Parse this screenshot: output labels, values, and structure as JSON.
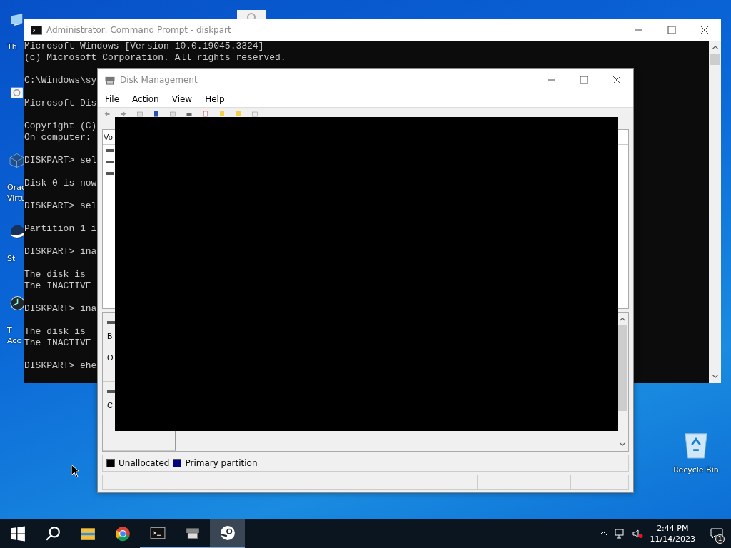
{
  "desktop_icons": [
    {
      "kind": "monitor",
      "labels": [
        "Th"
      ]
    },
    {
      "kind": "settings"
    },
    {
      "kind": "virtualbox",
      "labels": [
        "Orac",
        "Virtu"
      ]
    },
    {
      "kind": "steam",
      "labels": [
        "St"
      ]
    },
    {
      "kind": "clock",
      "labels": [
        "T",
        "Acc"
      ]
    }
  ],
  "recycle_bin": {
    "label": "Recycle Bin"
  },
  "command_prompt": {
    "title": "Administrator: Command Prompt - diskpart",
    "blocks": [
      [
        "Microsoft Windows [Version 10.0.19045.3324]",
        "(c) Microsoft Corporation. All rights reserved."
      ],
      [
        "C:\\Windows\\sy"
      ],
      [
        "Microsoft Dis"
      ],
      [
        "Copyright (C)",
        "On computer:"
      ],
      [
        "DISKPART> sel"
      ],
      [
        "Disk 0 is now"
      ],
      [
        "DISKPART> sel"
      ],
      [
        "Partition 1 i"
      ],
      [
        "DISKPART> ina"
      ],
      [
        "The disk is",
        "The INACTIVE"
      ],
      [
        "DISKPART> ina"
      ],
      [
        "The disk is",
        "The INACTIVE"
      ],
      [
        "DISKPART> ehe"
      ]
    ]
  },
  "disk_management": {
    "title": "Disk Management",
    "menu": [
      "File",
      "Action",
      "View",
      "Help"
    ],
    "volume_column": "Vo",
    "disk_labels": [
      [
        "B",
        "O"
      ],
      [
        "C"
      ]
    ],
    "legend": [
      {
        "label": "Unallocated",
        "color": "#000000"
      },
      {
        "label": "Primary partition",
        "color": "#000080"
      }
    ]
  },
  "taskbar": {
    "items": [
      {
        "kind": "start",
        "running": false,
        "selected": false
      },
      {
        "kind": "search",
        "running": false,
        "selected": false
      },
      {
        "kind": "explorer",
        "running": false,
        "selected": false
      },
      {
        "kind": "browser",
        "running": false,
        "selected": false
      },
      {
        "kind": "terminal",
        "running": true,
        "selected": false
      },
      {
        "kind": "disk",
        "running": true,
        "selected": false
      },
      {
        "kind": "steam",
        "running": true,
        "selected": true
      }
    ],
    "time": "2:44 PM",
    "date": "11/14/2023",
    "notifications": "1"
  }
}
